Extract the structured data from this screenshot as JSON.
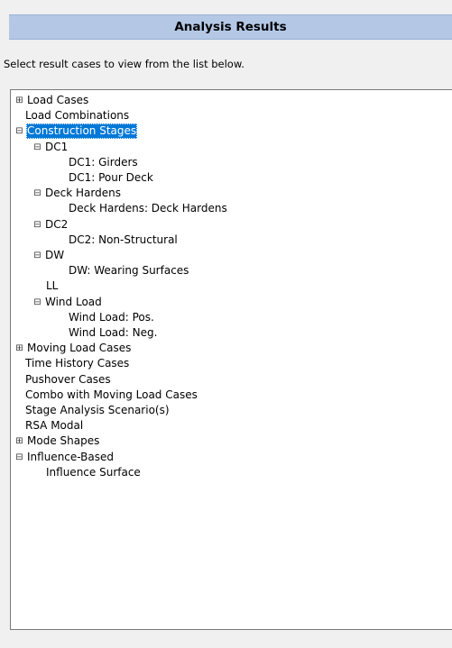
{
  "header": {
    "title": "Analysis Results"
  },
  "instructions": "Select result cases to view from the list below.",
  "icons": {
    "expanded": "⊟",
    "collapsed": "⊞"
  },
  "colors": {
    "header_bg": "#b4c8e6",
    "selection": "#0078d7"
  },
  "tree": [
    {
      "label": "Load Cases",
      "level": 0,
      "expander": "collapsed",
      "selected": false
    },
    {
      "label": "Load Combinations",
      "level": 0,
      "expander": "none",
      "selected": false
    },
    {
      "label": "Construction Stages",
      "level": 0,
      "expander": "expanded",
      "selected": true
    },
    {
      "label": "DC1",
      "level": 1,
      "expander": "expanded",
      "selected": false
    },
    {
      "label": "DC1: Girders",
      "level": 2,
      "expander": "none",
      "selected": false
    },
    {
      "label": "DC1: Pour Deck",
      "level": 2,
      "expander": "none",
      "selected": false
    },
    {
      "label": "Deck Hardens",
      "level": 1,
      "expander": "expanded",
      "selected": false
    },
    {
      "label": "Deck Hardens: Deck Hardens",
      "level": 2,
      "expander": "none",
      "selected": false
    },
    {
      "label": "DC2",
      "level": 1,
      "expander": "expanded",
      "selected": false
    },
    {
      "label": "DC2: Non-Structural",
      "level": 2,
      "expander": "none",
      "selected": false
    },
    {
      "label": "DW",
      "level": 1,
      "expander": "expanded",
      "selected": false
    },
    {
      "label": "DW: Wearing Surfaces",
      "level": 2,
      "expander": "none",
      "selected": false
    },
    {
      "label": "LL",
      "level": 1,
      "expander": "none",
      "selected": false
    },
    {
      "label": "Wind Load",
      "level": 1,
      "expander": "expanded",
      "selected": false
    },
    {
      "label": "Wind Load: Pos.",
      "level": 2,
      "expander": "none",
      "selected": false
    },
    {
      "label": "Wind Load: Neg.",
      "level": 2,
      "expander": "none",
      "selected": false
    },
    {
      "label": "Moving Load Cases",
      "level": 0,
      "expander": "collapsed",
      "selected": false
    },
    {
      "label": "Time History Cases",
      "level": 0,
      "expander": "none",
      "selected": false
    },
    {
      "label": "Pushover Cases",
      "level": 0,
      "expander": "none",
      "selected": false
    },
    {
      "label": "Combo with Moving Load Cases",
      "level": 0,
      "expander": "none",
      "selected": false
    },
    {
      "label": "Stage Analysis Scenario(s)",
      "level": 0,
      "expander": "none",
      "selected": false
    },
    {
      "label": "RSA Modal",
      "level": 0,
      "expander": "none",
      "selected": false
    },
    {
      "label": "Mode Shapes",
      "level": 0,
      "expander": "collapsed",
      "selected": false
    },
    {
      "label": "Influence-Based",
      "level": 0,
      "expander": "expanded",
      "selected": false
    },
    {
      "label": "Influence Surface",
      "level": 1,
      "expander": "none",
      "selected": false
    }
  ]
}
